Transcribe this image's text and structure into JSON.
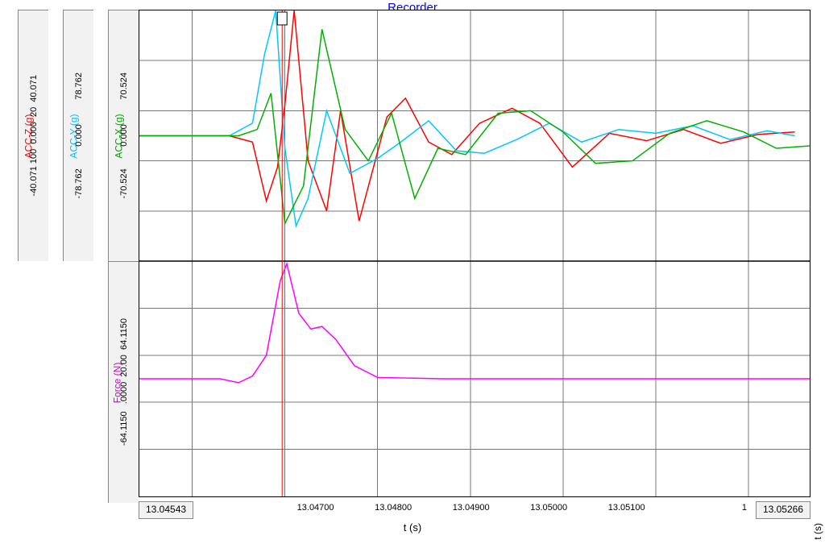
{
  "title": "Recorder",
  "xaxis": {
    "label": "t (s)",
    "start_readout": "13.04543",
    "end_readout": "13.05266",
    "ticks": [
      "13.04700",
      "13.04800",
      "13.04900",
      "13.05000",
      "13.05100"
    ],
    "tick_partial": "1"
  },
  "right_edge_label": "t (s)",
  "yaxes": {
    "acc_z": {
      "label": "ACC-Z (g)",
      "ticks": "-40.071 100  0.000  20  40.071"
    },
    "acc_y": {
      "label": "ACC-Y (g)",
      "ticks": "-78.762         0.000          78.762"
    },
    "acc_x": {
      "label": "ACC-X (g)",
      "ticks": "-70.524         0.000          70.524"
    },
    "force": {
      "label": "Force (N)",
      "ticks": "-64.1150   .0000  20.00  64.1150"
    }
  },
  "cursor_t": 13.04697,
  "chart_data": {
    "type": "line",
    "title": "Recorder",
    "xlabel": "t (s)",
    "xlim": [
      13.04543,
      13.05266
    ],
    "panel_upper_ylim": [
      -100,
      100
    ],
    "panel_lower_ylim": [
      -90,
      90
    ],
    "series": [
      {
        "name": "ACC-Z (g)",
        "color": "#ff0000",
        "x": [
          13.04543,
          13.0464,
          13.04665,
          13.0468,
          13.04692,
          13.047,
          13.0471,
          13.04725,
          13.04745,
          13.0476,
          13.0478,
          13.0481,
          13.0483,
          13.04855,
          13.0488,
          13.0491,
          13.04945,
          13.04975,
          13.0501,
          13.0505,
          13.0509,
          13.0513,
          13.0517,
          13.0521,
          13.0525
        ],
        "y": [
          0,
          0,
          -5,
          -52,
          -25,
          25,
          100,
          -20,
          -60,
          20,
          -68,
          15,
          30,
          -5,
          -15,
          10,
          22,
          10,
          -25,
          2,
          -4,
          5,
          -6,
          1,
          3
        ]
      },
      {
        "name": "ACC-Y (g)",
        "color": "#00c8ff",
        "x": [
          13.04543,
          13.0464,
          13.04665,
          13.04678,
          13.0469,
          13.047,
          13.04712,
          13.04725,
          13.04745,
          13.0477,
          13.048,
          13.04825,
          13.04855,
          13.04885,
          13.04915,
          13.0495,
          13.04985,
          13.0502,
          13.0506,
          13.051,
          13.0514,
          13.0518,
          13.0522,
          13.0525
        ],
        "y": [
          0,
          0,
          10,
          65,
          100,
          -10,
          -72,
          -50,
          20,
          -30,
          -18,
          -5,
          12,
          -12,
          -14,
          -3,
          10,
          -5,
          5,
          2,
          8,
          -3,
          4,
          0
        ]
      },
      {
        "name": "ACC-X (g)",
        "color": "#00b000",
        "x": [
          13.04543,
          13.0465,
          13.0467,
          13.04685,
          13.047,
          13.0472,
          13.0474,
          13.04765,
          13.0479,
          13.04815,
          13.0484,
          13.04865,
          13.04895,
          13.0493,
          13.04965,
          13.05,
          13.05035,
          13.05075,
          13.05115,
          13.05155,
          13.05195,
          13.0523,
          13.05266
        ],
        "y": [
          0,
          0,
          5,
          34,
          -70,
          -40,
          85,
          5,
          -20,
          18,
          -50,
          -10,
          -15,
          18,
          20,
          3,
          -22,
          -20,
          2,
          12,
          3,
          -10,
          -8
        ]
      },
      {
        "name": "Force (N)",
        "color": "#ff00ff",
        "x": [
          13.04543,
          13.0463,
          13.0465,
          13.04665,
          13.0468,
          13.04695,
          13.04702,
          13.04715,
          13.04728,
          13.0474,
          13.04755,
          13.04775,
          13.048,
          13.0487,
          13.05266
        ],
        "y": [
          0,
          0,
          -3,
          2,
          18,
          75,
          88,
          50,
          38,
          40,
          30,
          10,
          1,
          0,
          0
        ]
      }
    ]
  }
}
